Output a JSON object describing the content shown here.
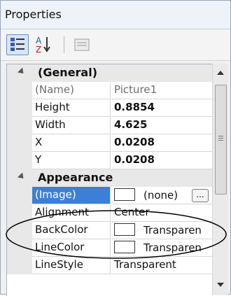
{
  "panel": {
    "title": "Properties"
  },
  "toolbar": {
    "categorized_icon": "categorized-view-icon",
    "alphabetical_icon": "sort-az-icon",
    "property_pages_icon": "property-pages-icon"
  },
  "grid": {
    "categories": [
      {
        "label": "(General)",
        "rows": [
          {
            "name": "(Name)",
            "value": "Picture1"
          },
          {
            "name": "Height",
            "value": "0.8854"
          },
          {
            "name": "Width",
            "value": "4.625"
          },
          {
            "name": "X",
            "value": "0.0208"
          },
          {
            "name": "Y",
            "value": "0.0208"
          }
        ]
      },
      {
        "label": "Appearance",
        "rows": [
          {
            "name": "(Image)",
            "value": "(none)",
            "button": "..."
          },
          {
            "name": "Alignment",
            "value": "Center"
          },
          {
            "name": "BackColor",
            "value": "Transparen"
          },
          {
            "name": "LineColor",
            "value": "Transparen"
          },
          {
            "name": "LineStyle",
            "value": "Transparent"
          }
        ]
      }
    ]
  },
  "colors": {
    "selection": "#3c7fd8",
    "annotation": "#000000"
  }
}
